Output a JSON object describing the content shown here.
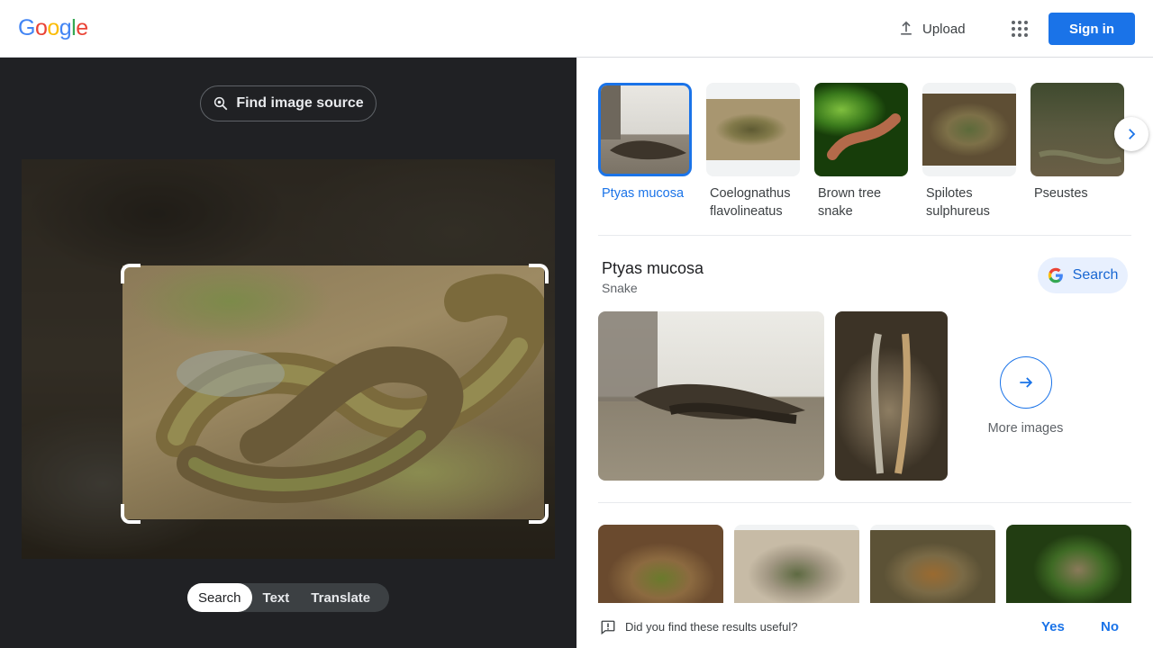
{
  "header": {
    "logo_letters": [
      "G",
      "o",
      "o",
      "g",
      "l",
      "e"
    ],
    "logo_colors": [
      "#4285f4",
      "#ea4335",
      "#fbbc05",
      "#4285f4",
      "#34a853",
      "#ea4335"
    ],
    "upload_label": "Upload",
    "signin_label": "Sign in"
  },
  "left": {
    "find_source_label": "Find image source",
    "modes": [
      "Search",
      "Text",
      "Translate"
    ],
    "active_mode": "Search"
  },
  "right": {
    "thumbnails": [
      {
        "label": "Ptyas mucosa",
        "selected": true
      },
      {
        "label": "Coelognathus flavolineatus",
        "selected": false
      },
      {
        "label": "Brown tree snake",
        "selected": false
      },
      {
        "label": "Spilotes sulphureus",
        "selected": false
      },
      {
        "label": "Pseustes",
        "selected": false
      }
    ],
    "entity": {
      "title": "Ptyas mucosa",
      "subtitle": "Snake",
      "search_label": "Search",
      "more_images_label": "More images"
    },
    "feedback": {
      "question": "Did you find these results useful?",
      "yes": "Yes",
      "no": "No"
    }
  },
  "colors": {
    "accent": "#1a73e8",
    "dark_panel": "#202124"
  }
}
